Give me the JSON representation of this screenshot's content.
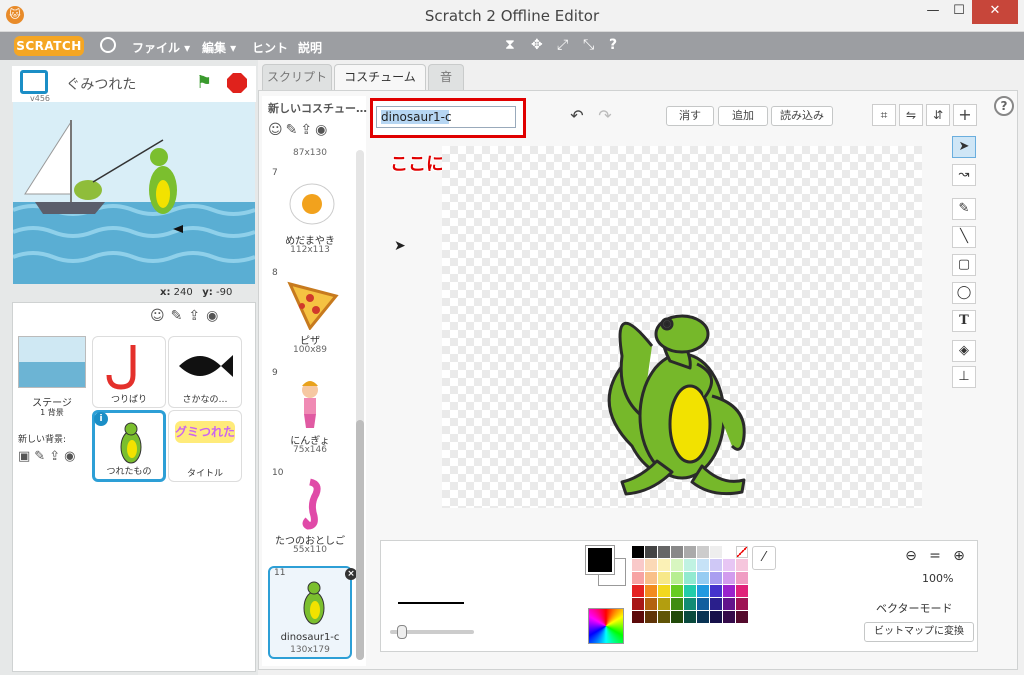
{
  "window": {
    "title": "Scratch 2 Offline Editor",
    "min": "—",
    "max": "☐",
    "close": "✕"
  },
  "menu": {
    "logo": "SCRATCH",
    "items": [
      "ファイル ▾",
      "編集 ▾",
      "ヒント",
      "説明"
    ],
    "tools": [
      "⧗",
      "✥",
      "⤢",
      "⤡",
      "?"
    ]
  },
  "stage": {
    "version": "v456",
    "project_name": "ぐみつれた",
    "x_label": "x:",
    "x": "240",
    "y_label": "y:",
    "y": "-90"
  },
  "sprites_pane": {
    "stage_label": "ステージ",
    "stage_count": "1 背景",
    "new_backdrop_label": "新しい背景:",
    "sprites": [
      {
        "name": "つりばり"
      },
      {
        "name": "さかなの…"
      },
      {
        "name": "つれたもの"
      },
      {
        "name": "タイトル"
      }
    ],
    "title_thumb_text": "グミつれた"
  },
  "tabs": [
    "スクリプト",
    "コスチューム",
    "音"
  ],
  "costume_list": {
    "new_costume_label": "新しいコスチュー…",
    "top_size": "87x130",
    "items": [
      {
        "num": "7",
        "name": "めだまやき",
        "size": "112x113"
      },
      {
        "num": "8",
        "name": "ピザ",
        "size": "100x89"
      },
      {
        "num": "9",
        "name": "にんぎょ",
        "size": "75x146"
      },
      {
        "num": "10",
        "name": "たつのおとしご",
        "size": "55x110"
      },
      {
        "num": "11",
        "name": "dinosaur1-c",
        "size": "130x179"
      }
    ]
  },
  "editor": {
    "costume_name": "dinosaur1-c",
    "clear": "消す",
    "add": "追加",
    "import": "読み込み",
    "annotation": "ここにコスチューム名をいれる",
    "zoom": "100%",
    "mode": "ベクターモード",
    "convert": "ビットマップに変換"
  },
  "colors": {
    "accent": "#1b8ec6",
    "highlight": "#e00000",
    "dino": "#76b82a"
  }
}
